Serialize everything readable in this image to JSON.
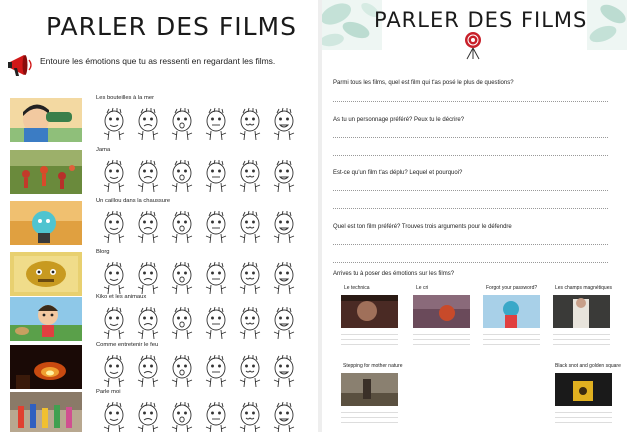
{
  "left": {
    "title": "PARLER DES FILMS",
    "instruction": "Entoure les émotions que tu as ressenti en regardant les films.",
    "films": [
      {
        "title": "Les bouteilles à la mer"
      },
      {
        "title": "Jama"
      },
      {
        "title": "Un caillou dans la chaussure"
      },
      {
        "title": "Blorg"
      },
      {
        "title": "Kiko et les animaux"
      },
      {
        "title": "Comme entretenir le feu"
      },
      {
        "title": "Parle moi"
      }
    ]
  },
  "right": {
    "title": "PARLER DES FILMS",
    "questions": [
      {
        "text": "Parmi tous les films, quel est film qui t'as posé le plus de questions?"
      },
      {
        "text": "As tu un personnage préféré? Peux tu le décrire?"
      },
      {
        "text": "Est-ce qu'un film t'as déplu? Lequel et pourquoi?"
      },
      {
        "text": "Quel est ton film préféré? Trouves trois arguments pour le défendre"
      },
      {
        "text": "Arrives tu à poser des émotions sur les films?"
      }
    ],
    "films": [
      {
        "title": "Le technica"
      },
      {
        "title": "Le cri"
      },
      {
        "title": "Forgot your password?"
      },
      {
        "title": "Les champs magnétiques"
      },
      {
        "title": "Stepping for mother nature"
      },
      {
        "title": "Black snot and golden square"
      }
    ]
  }
}
